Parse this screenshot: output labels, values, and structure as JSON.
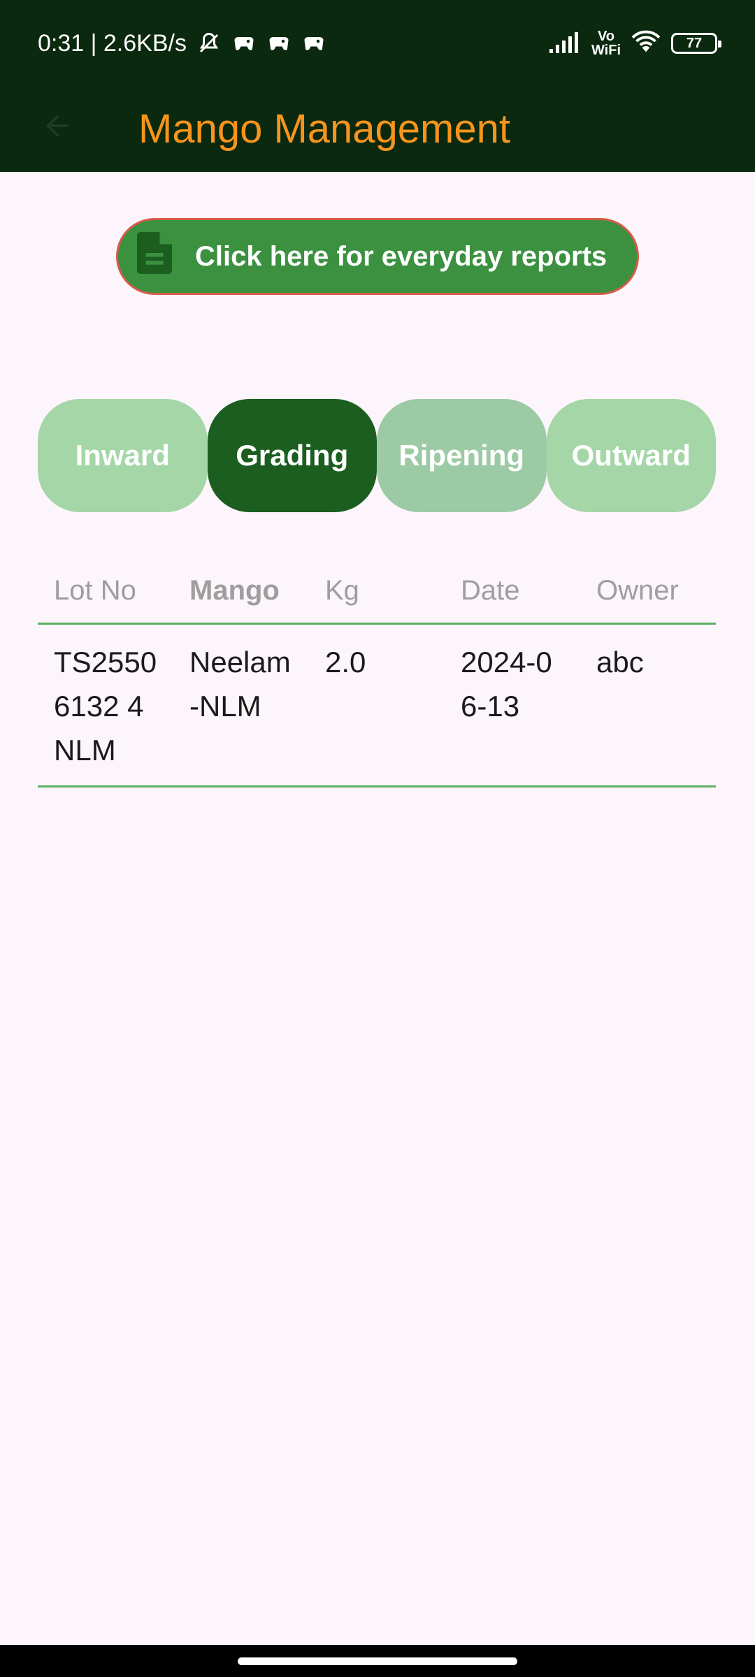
{
  "status_bar": {
    "time_speed": "0:31 | 2.6KB/s",
    "icons": [
      "mute-icon",
      "game-icon",
      "game-icon",
      "game-icon"
    ],
    "vowifi_top": "Vo",
    "vowifi_bottom": "WiFi",
    "battery": "77"
  },
  "app_bar": {
    "title": "Mango Management",
    "back_icon": "arrow-back-icon"
  },
  "reports_button": {
    "label": "Click here for everyday reports",
    "icon": "document-icon"
  },
  "tabs": [
    {
      "label": "Inward",
      "selected": false
    },
    {
      "label": "Grading",
      "selected": true
    },
    {
      "label": "Ripening",
      "selected": false
    },
    {
      "label": "Outward",
      "selected": false
    }
  ],
  "table": {
    "headers": [
      "Lot No",
      "Mango",
      "Kg",
      "Date",
      "Owner"
    ],
    "rows": [
      {
        "lot_no": "TS25506132 4NLM",
        "mango": "Neelam-NLM",
        "kg": "2.0",
        "date": "2024-06-13",
        "owner": "abc"
      }
    ]
  },
  "colors": {
    "topbar": "#0a290e",
    "title": "#f7941d",
    "accent": "#1b5e20",
    "background": "#fdf5fc"
  }
}
